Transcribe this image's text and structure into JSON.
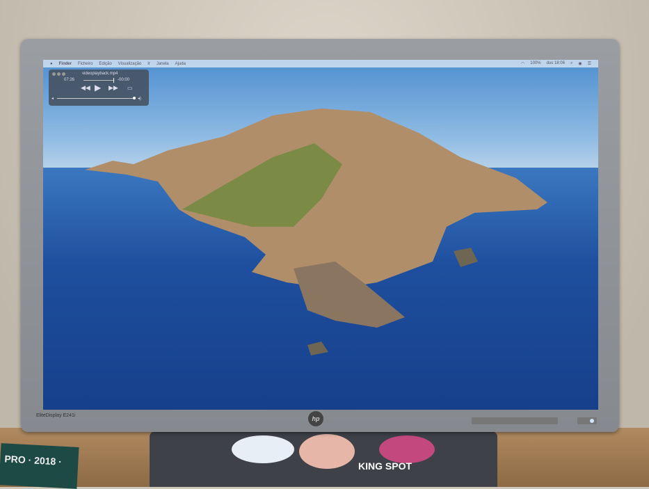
{
  "menubar": {
    "apple": "",
    "items": [
      "Finder",
      "Ficheiro",
      "Edição",
      "Visualização",
      "Ir",
      "Janela",
      "Ajuda"
    ],
    "battery": "100%",
    "clock": "dus 18:06"
  },
  "player": {
    "filename": "videoplayback.mp4",
    "elapsed": "07:26",
    "remaining": "-00:00",
    "progress": 0.99,
    "volume": 0.95,
    "icons": [
      "rewind-icon",
      "play-icon",
      "fast-forward-icon",
      "airplay-icon"
    ]
  },
  "monitor": {
    "model": "EliteDisplay E241i",
    "logo": "hp"
  },
  "stickers": {
    "pro": "PRO · 2018 ·",
    "king": "KING SPOT"
  },
  "colors": {
    "sea": "#1e4f9e",
    "sky": "#8fbbe3",
    "bezel": "#8e9297"
  }
}
